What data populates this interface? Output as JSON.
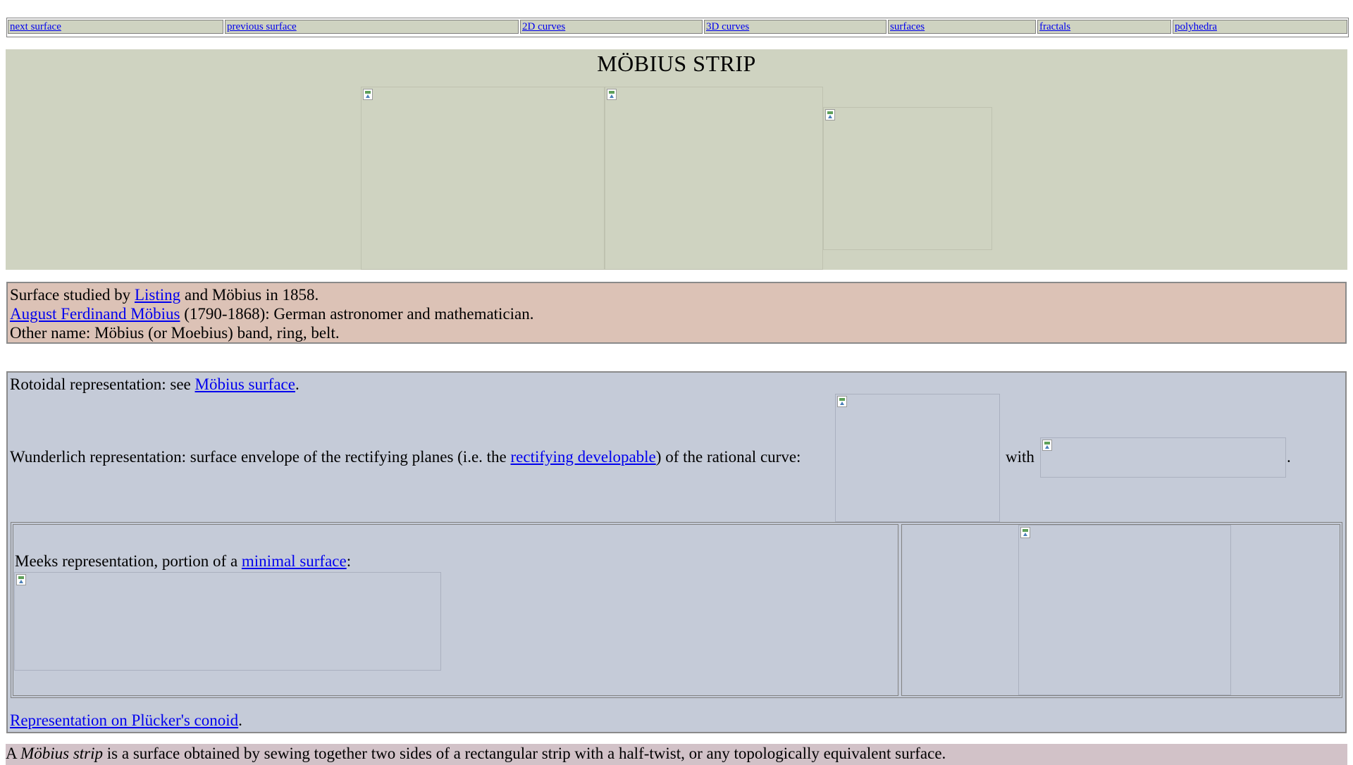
{
  "nav": {
    "next": "next surface",
    "previous": "previous surface",
    "curves2d": "2D curves",
    "curves3d": "3D curves",
    "surfaces": "surfaces",
    "fractals": "fractals",
    "polyhedra": "polyhedra"
  },
  "title": "MÖBIUS STRIP",
  "info": {
    "line1_pre": "Surface studied by ",
    "line1_link": "Listing",
    "line1_post": " and Möbius in 1858.",
    "line2_link": "August Ferdinand Möbius",
    "line2_post": " (1790-1868): German astronomer and mathematician.",
    "line3": "Other name: Möbius (or Moebius) band, ring, belt."
  },
  "rep": {
    "rotoidal_pre": "Rotoidal representation: see ",
    "rotoidal_link": "Möbius surface",
    "rotoidal_post": ".",
    "wunder_pre": "Wunderlich representation: surface envelope of the rectifying planes (i.e. the ",
    "wunder_link": "rectifying developable",
    "wunder_post": ") of the rational curve:",
    "with": "with",
    "period": ".",
    "meeks_pre": "Meeks representation, portion of a ",
    "meeks_link": "minimal surface",
    "meeks_post": ":",
    "plucker_link": "Representation on Plücker's conoid",
    "plucker_post": "."
  },
  "definition": {
    "pre": "A ",
    "term": "Möbius strip",
    "post": " is a surface obtained by sewing together two sides of a rectangular strip with a half-twist, or any topologically equivalent surface."
  },
  "colors": {
    "nav_bg": "#cfd3c1",
    "title_band": "#cfd3c1",
    "info_band": "#dcc2b6",
    "rep_band": "#c5cbd8",
    "definition_band": "#d2c2c8",
    "link": "#0000ee"
  }
}
